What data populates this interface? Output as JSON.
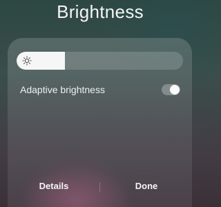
{
  "header": {
    "title": "Brightness"
  },
  "brightness_slider": {
    "level_percent": 29,
    "icon": "sun-icon"
  },
  "adaptive_brightness": {
    "label": "Adaptive brightness",
    "enabled": false
  },
  "footer": {
    "details_label": "Details",
    "done_label": "Done"
  },
  "colors": {
    "text": "#f5f5f5",
    "slider_fill": "#f6f6f6"
  }
}
